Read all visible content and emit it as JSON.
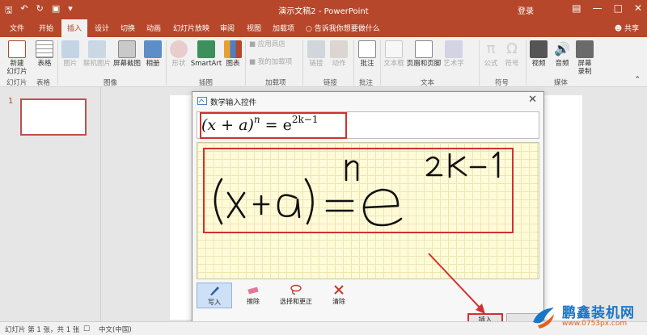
{
  "titlebar": {
    "title": "演示文稿2 - PowerPoint",
    "login": "登录"
  },
  "tabs": [
    {
      "label": "文件"
    },
    {
      "label": "开始"
    },
    {
      "label": "插入"
    },
    {
      "label": "设计"
    },
    {
      "label": "切换"
    },
    {
      "label": "动画"
    },
    {
      "label": "幻灯片放映"
    },
    {
      "label": "审阅"
    },
    {
      "label": "视图"
    },
    {
      "label": "加载项"
    }
  ],
  "tellme": "告诉我你想要做什么",
  "share": "共享",
  "ribbon": {
    "buttons": {
      "new_slide": "新建\n幻灯片",
      "table": "表格",
      "picture": "图片",
      "online_picture": "联机图片",
      "screenshot": "屏幕截图",
      "album": "相册",
      "shapes": "形状",
      "smartart": "SmartArt",
      "chart": "图表",
      "store": "应用商店",
      "my_addins": "我的加载项",
      "link": "链接",
      "action": "动作",
      "comment": "批注",
      "textbox": "文本框",
      "header_footer": "页眉和页脚",
      "wordart": "艺术字",
      "equation": "公式",
      "symbol": "符号",
      "video": "视频",
      "audio": "音频",
      "screen_record": "屏幕\n录制"
    },
    "groups": {
      "slides": "幻灯片",
      "tables": "表格",
      "images": "图像",
      "illustrations": "插图",
      "addins": "加载项",
      "links": "链接",
      "comments": "批注",
      "text": "文本",
      "symbols": "符号",
      "media": "媒体"
    }
  },
  "thumbnails": {
    "slide_number": "1"
  },
  "dialog": {
    "title": "数学输入控件",
    "preview": {
      "base": "(x + a)",
      "exp": "n",
      "equals": " = e",
      "power": "2k−1"
    },
    "tools": [
      {
        "label": "写入",
        "icon": "pen-icon",
        "selected": true
      },
      {
        "label": "擦除",
        "icon": "eraser-icon",
        "selected": false
      },
      {
        "label": "选择和更正",
        "icon": "lasso-icon",
        "selected": false
      },
      {
        "label": "清除",
        "icon": "clear-icon",
        "selected": false
      }
    ],
    "insert_label": "插入"
  },
  "status": {
    "slide_info": "幻灯片 第 1 张，共 1 张",
    "language": "中文(中国)"
  },
  "watermark": {
    "brand": "鹏鑫装机网",
    "url": "www.0753px.com"
  },
  "colors": {
    "accent": "#b7472a",
    "highlight": "#d23030",
    "ink": "#111111"
  }
}
